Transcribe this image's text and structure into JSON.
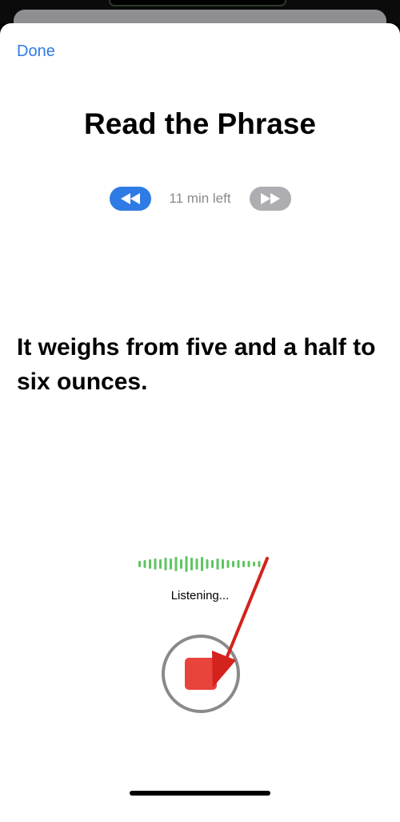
{
  "header": {
    "done_label": "Done"
  },
  "title": "Read the Phrase",
  "timer": {
    "remaining_text": "11 min left",
    "back_icon": "rewind-icon",
    "forward_icon": "fast-forward-icon"
  },
  "phrase": "It weighs from five and a half to six ounces.",
  "recording": {
    "status_text": "Listening...",
    "stop_icon": "stop-icon"
  },
  "colors": {
    "accent": "#2f7be5",
    "waveform": "#5ec561",
    "stop": "#e9433d",
    "annotation_arrow": "#d4221c"
  }
}
